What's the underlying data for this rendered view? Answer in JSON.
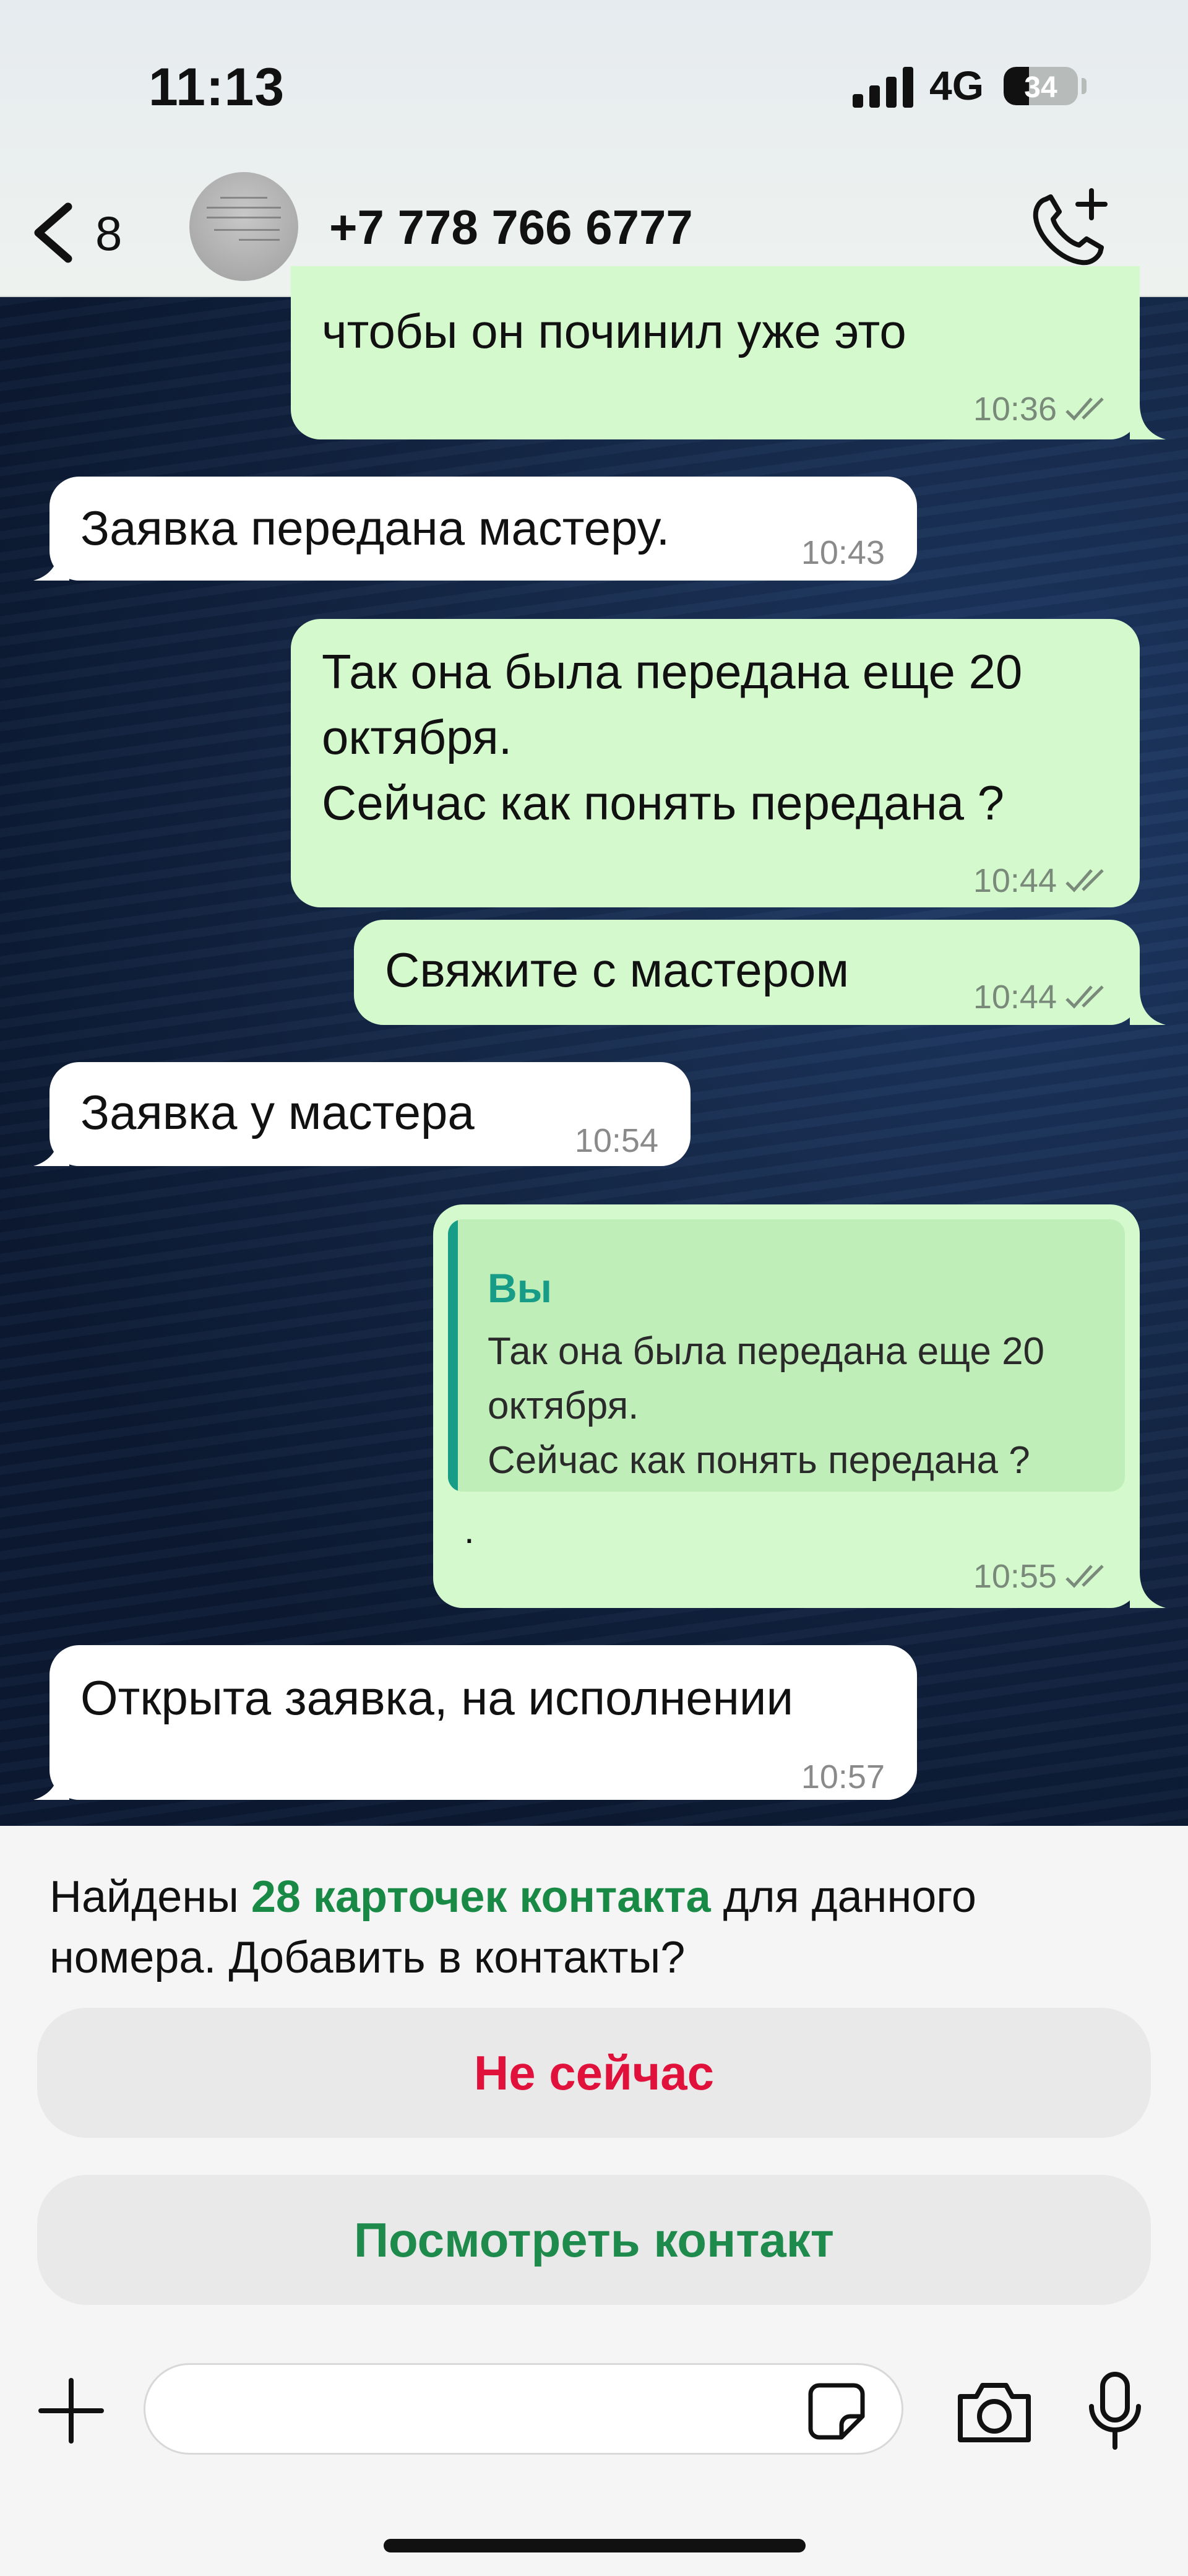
{
  "status_bar": {
    "time": "11:13",
    "network": "4G",
    "battery_level": "34",
    "battery_fraction": 0.34
  },
  "header": {
    "back_count": "8",
    "contact_title": "+7 778 766 6777",
    "icons": {
      "back": "chevron-left-icon",
      "call": "phone-add-icon"
    }
  },
  "messages": [
    {
      "direction": "out",
      "text_lines": [
        "чтобы он починил уже это"
      ],
      "time": "10:36",
      "status": "read"
    },
    {
      "direction": "in",
      "text_lines": [
        "Заявка передана мастеру."
      ],
      "time": "10:43"
    },
    {
      "direction": "out",
      "text_lines": [
        "Так она была передана еще 20",
        "октября.",
        "Сейчас как понять передана ?"
      ],
      "time": "10:44",
      "status": "read"
    },
    {
      "direction": "out",
      "text_lines": [
        "Свяжите с мастером"
      ],
      "time": "10:44",
      "status": "read"
    },
    {
      "direction": "in",
      "text_lines": [
        "Заявка у мастера"
      ],
      "time": "10:54"
    },
    {
      "direction": "out",
      "quote": {
        "author": "Вы",
        "text": "Так она была передана еще 20\nоктября.\nСейчас как понять передана ?"
      },
      "text_lines": [
        "."
      ],
      "time": "10:55",
      "status": "read"
    },
    {
      "direction": "in",
      "text_lines": [
        "Открыта заявка, на исполнении"
      ],
      "time": "10:57"
    }
  ],
  "contact_prompt": {
    "text_before": "Найдены ",
    "highlight": "28 карточек контакта",
    "text_after": " для данного номера. Добавить в контакты?",
    "dismiss_label": "Не сейчас",
    "view_label": "Посмотреть контакт"
  },
  "composer": {
    "input_value": "",
    "icons": {
      "attach": "plus-icon",
      "sticker": "sticker-icon",
      "camera": "camera-icon",
      "voice": "microphone-icon"
    }
  },
  "colors": {
    "outgoing_bubble": "#d4f9cd",
    "incoming_bubble": "#ffffff",
    "quote_author": "#169c87",
    "highlight_green": "#198a45",
    "dismiss_red": "#e0113a",
    "view_green": "#1e8a4c"
  }
}
